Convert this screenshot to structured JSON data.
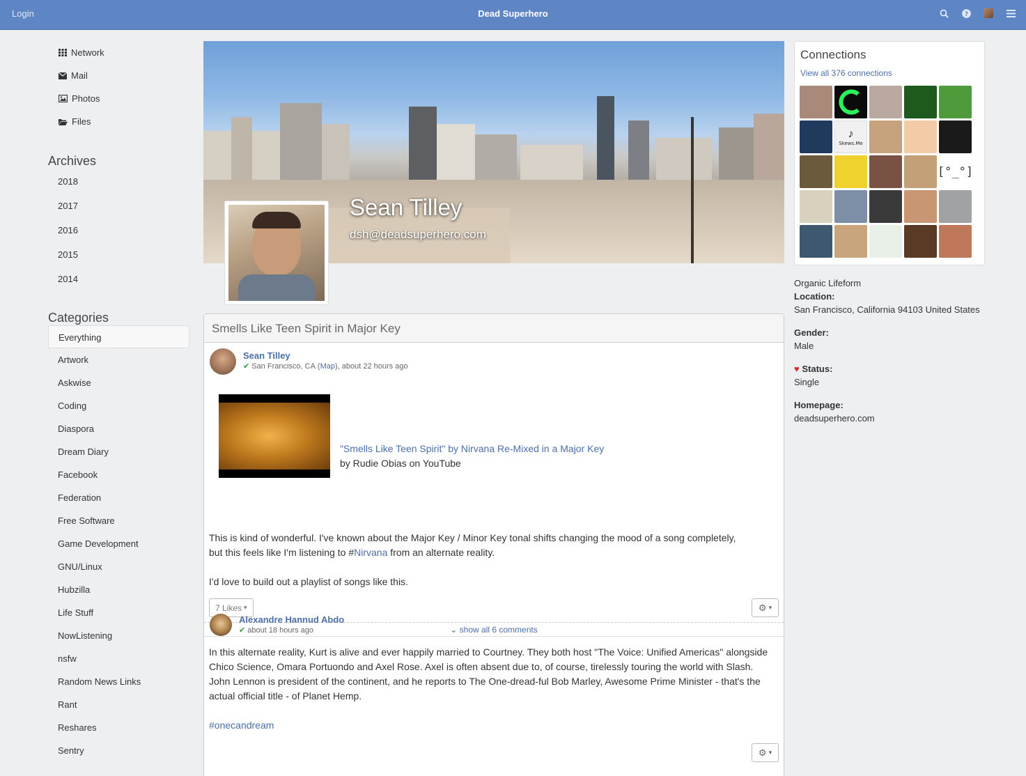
{
  "navbar": {
    "login": "Login",
    "title": "Dead Superhero",
    "icons": [
      "search-icon",
      "help-icon",
      "user-avatar",
      "menu-icon"
    ]
  },
  "apps": [
    {
      "label": "Network",
      "icon": "grid-icon"
    },
    {
      "label": "Mail",
      "icon": "envelope-icon"
    },
    {
      "label": "Photos",
      "icon": "image-icon"
    },
    {
      "label": "Files",
      "icon": "folder-icon"
    }
  ],
  "archives": {
    "title": "Archives",
    "years": [
      "2018",
      "2017",
      "2016",
      "2015",
      "2014"
    ]
  },
  "categories": {
    "title": "Categories",
    "items": [
      "Everything",
      "Artwork",
      "Askwise",
      "Coding",
      "Diaspora",
      "Dream Diary",
      "Facebook",
      "Federation",
      "Free Software",
      "Game Development",
      "GNU/Linux",
      "Hubzilla",
      "Life Stuff",
      "NowListening",
      "nsfw",
      "Random News Links",
      "Rant",
      "Reshares",
      "Sentry"
    ],
    "active": "Everything"
  },
  "profile": {
    "name": "Sean Tilley",
    "handle": "dsh@deadsuperhero.com"
  },
  "page": {
    "title": "Smells Like Teen Spirit in Major Key"
  },
  "post1": {
    "author": "Sean Tilley",
    "location": "San Francisco, CA",
    "map": "Map",
    "time": ", about 22 hours ago",
    "embed_title": "\"Smells Like Teen Spirit\" by Nirvana Re-Mixed in a Major Key",
    "embed_by": "by Rudie Obias on YouTube",
    "text1_a": "This is kind of wonderful. I've known about the Major Key / Minor Key tonal shifts changing the mood of a song completely,",
    "text1_b_pre": "but this feels like I'm listening to #",
    "text1_b_link": "Nirvana",
    "text1_b_post": " from an alternate reality.",
    "text2": "I'd love to build out a playlist of songs like this.",
    "likes": "7 Likes",
    "show_comments": "show all 6 comments"
  },
  "comment1": {
    "author": "Alexandre Hannud Abdo",
    "time": "about 18 hours ago",
    "text": "In this alternate reality, Kurt is alive and ever happily married to Courtney. They both host \"The Voice: Unified Americas\" alongside Chico Science, Omara Portuondo and Axel Rose. Axel is often absent due to, of course, tirelessly touring the world with Slash. John Lennon is president of the continent, and he reports to The One-dread-ful Bob Marley, Awesome Prime Minister - that's the actual official title - of Planet Hemp.",
    "hashtag_prefix": "#",
    "hashtag": "onecandream"
  },
  "connections": {
    "title": "Connections",
    "link": "View all 376 connections",
    "colors": [
      "#a98a7a",
      "#0b0b0b",
      "#b9a9a0",
      "#1e5a1e",
      "#4f9a3a",
      "#1f3a5c",
      "#f0f0f0",
      "#c6a37c",
      "#f3cba6",
      "#1a1a1a",
      "#6b5a3c",
      "#f0d22e",
      "#7a5244",
      "#c3a077",
      "#ffffff",
      "#d8d1bd",
      "#7d8fa6",
      "#3a3a3a",
      "#c99674",
      "#a0a2a5",
      "#3e5870",
      "#c8a57c",
      "#e8f0e8",
      "#5b3a25",
      "#c0785a"
    ],
    "bracket_face": "[°_°]",
    "skews_label": "Skews.Me"
  },
  "about": {
    "tagline": "Organic Lifeform",
    "location_label": "Location:",
    "location": "San Francisco, California 94103 United States",
    "gender_label": "Gender:",
    "gender": "Male",
    "status_label": "Status:",
    "status": "Single",
    "homepage_label": "Homepage:",
    "homepage": "deadsuperhero.com"
  }
}
